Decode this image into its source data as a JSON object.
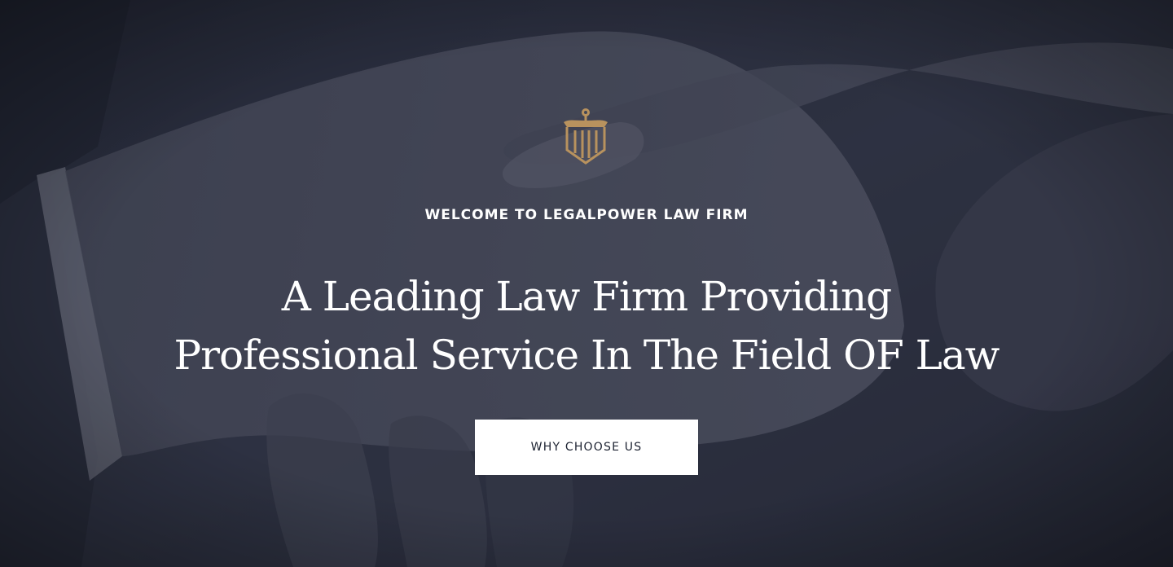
{
  "hero": {
    "logo_icon": "pillar-shield-icon",
    "eyebrow": "WELCOME TO LEGALPOWER LAW FIRM",
    "headline_line1": "A Leading Law Firm Providing",
    "headline_line2": "Professional Service In The Field OF Law",
    "cta_label": "WHY CHOOSE US",
    "background_image": "handshake-photo"
  },
  "colors": {
    "overlay": "#1e2230",
    "accent_gold": "#b8925e",
    "text": "#ffffff",
    "button_bg": "#ffffff",
    "button_text": "#1c2231"
  }
}
